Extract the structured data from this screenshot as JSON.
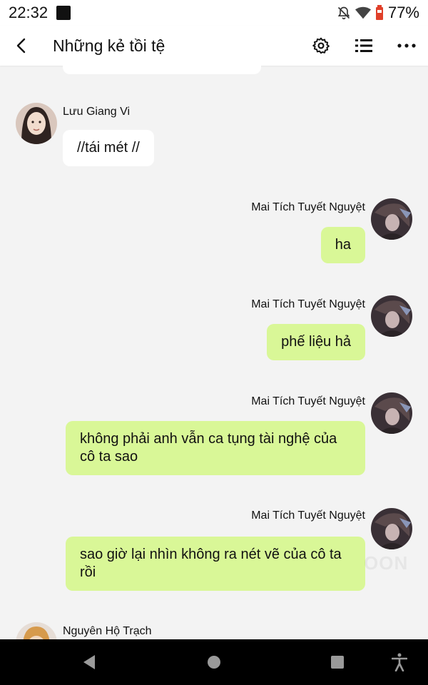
{
  "status_bar": {
    "time": "22:32",
    "battery": "77%",
    "icons": [
      "media-stop-icon",
      "bell-off-icon",
      "wifi-icon",
      "battery-icon"
    ]
  },
  "app_bar": {
    "title": "Những kẻ tồi tệ",
    "icons": [
      "back-arrow-icon",
      "gear-icon",
      "list-icon",
      "more-dots-icon"
    ]
  },
  "messages": [
    {
      "sender": "Lưu Giang Vi",
      "text": "//tái mét //",
      "side": "left"
    },
    {
      "sender": "Mai Tích Tuyết Nguyệt",
      "text": "ha",
      "side": "right"
    },
    {
      "sender": "Mai Tích Tuyết Nguyệt",
      "text": "phế liệu hả",
      "side": "right"
    },
    {
      "sender": "Mai Tích Tuyết Nguyệt",
      "text": "không phải anh vẫn ca tụng tài nghệ của cô ta sao",
      "side": "right"
    },
    {
      "sender": "Mai Tích Tuyết Nguyệt",
      "text": "sao giờ lại nhìn không ra nét vẽ của cô ta rồi",
      "side": "right"
    },
    {
      "sender": "Nguyên Hộ Trạch",
      "text": "",
      "side": "left"
    }
  ],
  "colors": {
    "my_bubble": "#d9f797",
    "other_bubble": "#ffffff",
    "chat_background": "#f3f3f3",
    "nav_bar": "#000000"
  },
  "nav_bar": {
    "icons": [
      "back-triangle-icon",
      "home-circle-icon",
      "recents-square-icon",
      "accessibility-icon"
    ]
  }
}
